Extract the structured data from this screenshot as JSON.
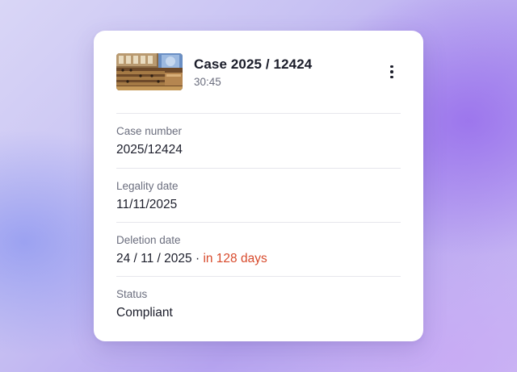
{
  "card": {
    "title": "Case 2025 / 12424",
    "duration": "30:45",
    "thumbnail_icon": "courtroom-thumbnail",
    "menu_icon": "more-vertical-icon"
  },
  "fields": [
    {
      "label": "Case number",
      "value": "2025/12424"
    },
    {
      "label": "Legality date",
      "value": "11/11/2025"
    },
    {
      "label": "Deletion date",
      "value": "24 / 11 / 2025",
      "separator": " · ",
      "note": "in 128 days"
    },
    {
      "label": "Status",
      "value": "Compliant"
    }
  ],
  "colors": {
    "accent": "#d84a2c",
    "text_primary": "#1b1d2a",
    "text_secondary": "#6b6e7e"
  }
}
